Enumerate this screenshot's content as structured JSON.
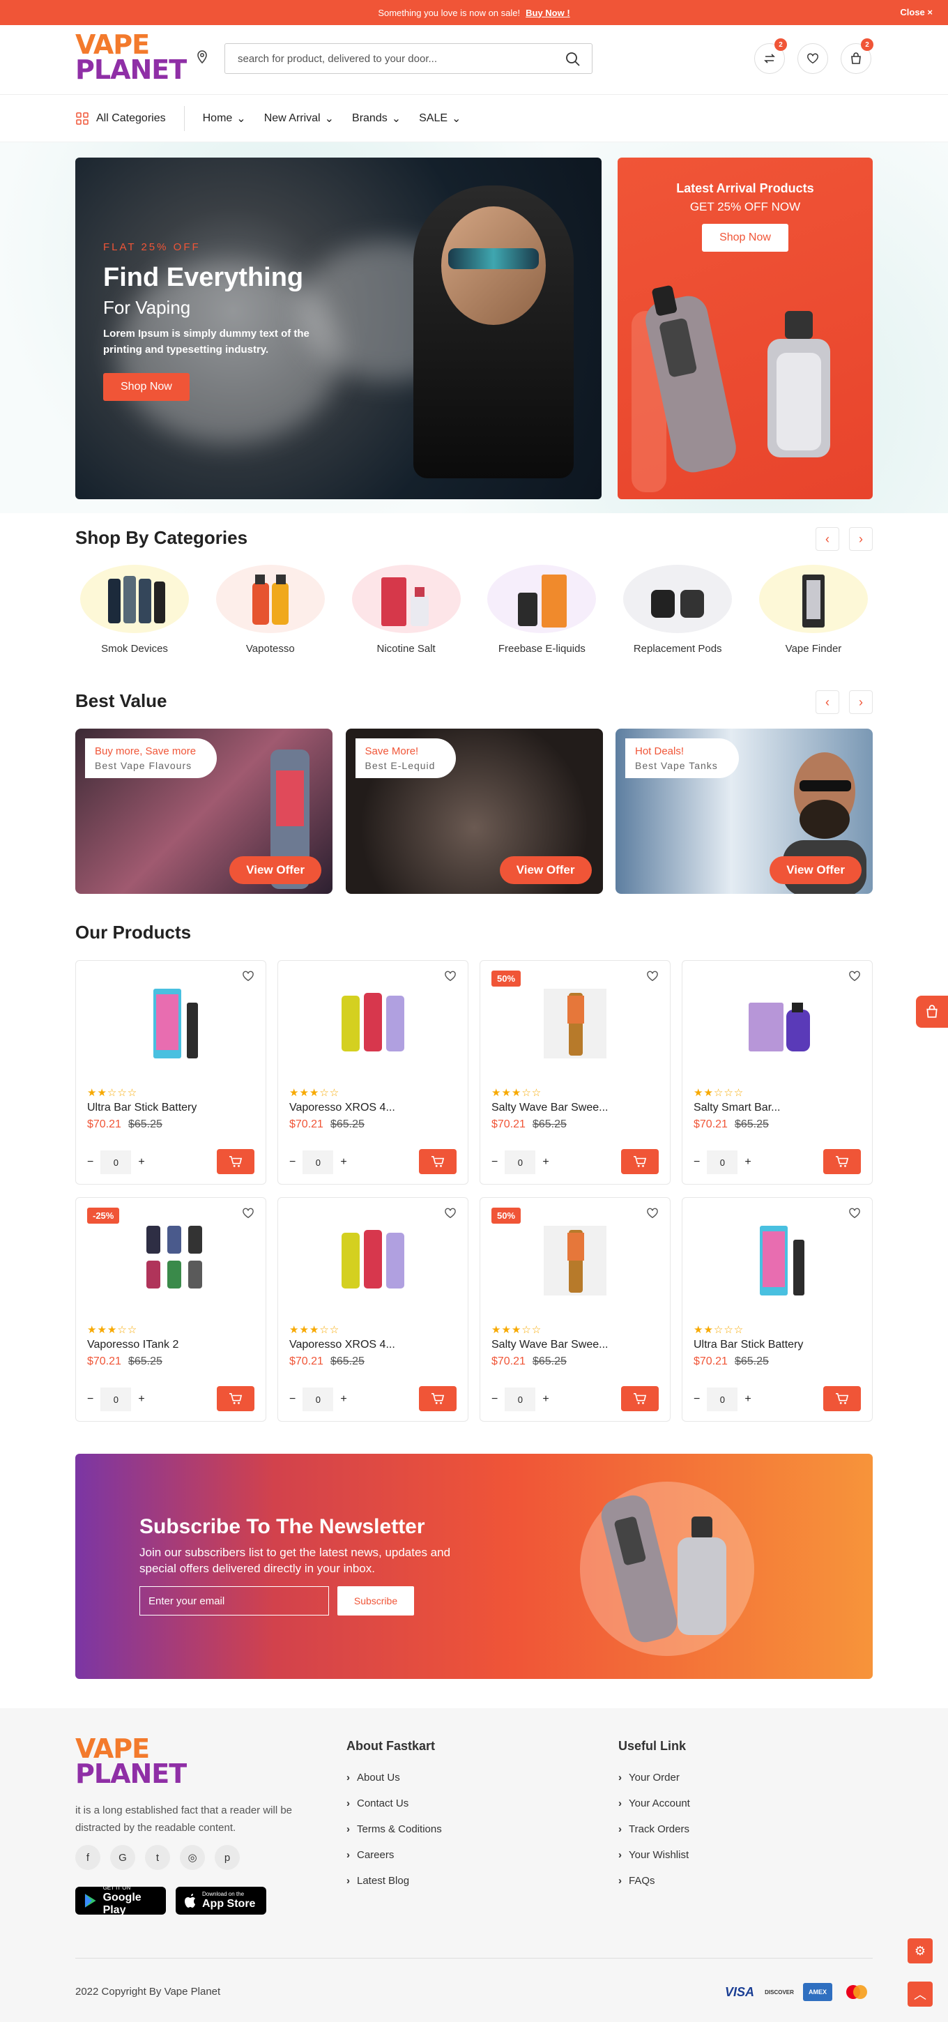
{
  "topbar": {
    "message": "Something you love is now on sale!",
    "buy": "Buy Now !",
    "close": "Close ×"
  },
  "brand": {
    "line1": "VAPE",
    "line2": "PLANET"
  },
  "search": {
    "placeholder": "search for product, delivered to your door..."
  },
  "header": {
    "compare_count": "2",
    "cart_count": "2"
  },
  "nav": {
    "all_categories": "All Categories",
    "items": [
      "Home",
      "New Arrival",
      "Brands",
      "SALE"
    ]
  },
  "hero": {
    "flat": "FLAT 25% OFF",
    "title": "Find Everything",
    "subtitle": "For Vaping",
    "desc": "Lorem Ipsum is simply dummy text of the printing and typesetting industry.",
    "button": "Shop Now",
    "right_title": "Latest Arrival Products",
    "right_sub": "GET 25% OFF NOW",
    "right_button": "Shop Now"
  },
  "categories": {
    "title": "Shop By Categories",
    "items": [
      {
        "label": "Smok Devices",
        "bg": "#fdf8d7"
      },
      {
        "label": "Vapotesso",
        "bg": "#fdeeea"
      },
      {
        "label": "Nicotine Salt",
        "bg": "#fde5e8"
      },
      {
        "label": "Freebase E-liquids",
        "bg": "#f6eefb"
      },
      {
        "label": "Replacement Pods",
        "bg": "#f0f0f3"
      },
      {
        "label": "Vape Finder",
        "bg": "#fdf8d7"
      }
    ]
  },
  "best_value": {
    "title": "Best Value",
    "offers": [
      {
        "t1": "Buy more, Save more",
        "t2": "Best Vape Flavours",
        "button": "View Offer"
      },
      {
        "t1": "Save More!",
        "t2": "Best E-Lequid",
        "button": "View Offer"
      },
      {
        "t1": "Hot Deals!",
        "t2": "Best Vape Tanks",
        "button": "View Offer"
      }
    ]
  },
  "products": {
    "title": "Our Products",
    "items": [
      {
        "name": "Ultra Bar Stick Battery",
        "price": "$70.21",
        "old": "$65.25",
        "qty": "0",
        "stars": "★★☆☆☆",
        "discount": ""
      },
      {
        "name": "Vaporesso XROS 4...",
        "price": "$70.21",
        "old": "$65.25",
        "qty": "0",
        "stars": "★★★☆☆",
        "discount": ""
      },
      {
        "name": "Salty Wave Bar Swee...",
        "price": "$70.21",
        "old": "$65.25",
        "qty": "0",
        "stars": "★★★☆☆",
        "discount": "50%"
      },
      {
        "name": "Salty Smart Bar...",
        "price": "$70.21",
        "old": "$65.25",
        "qty": "0",
        "stars": "★★☆☆☆",
        "discount": ""
      },
      {
        "name": "Vaporesso ITank 2",
        "price": "$70.21",
        "old": "$65.25",
        "qty": "0",
        "stars": "★★★☆☆",
        "discount": "-25%"
      },
      {
        "name": "Vaporesso XROS 4...",
        "price": "$70.21",
        "old": "$65.25",
        "qty": "0",
        "stars": "★★★☆☆",
        "discount": ""
      },
      {
        "name": "Salty Wave Bar Swee...",
        "price": "$70.21",
        "old": "$65.25",
        "qty": "0",
        "stars": "★★★☆☆",
        "discount": "50%"
      },
      {
        "name": "Ultra Bar Stick Battery",
        "price": "$70.21",
        "old": "$65.25",
        "qty": "0",
        "stars": "★★☆☆☆",
        "discount": ""
      }
    ]
  },
  "newsletter": {
    "title": "Subscribe To The Newsletter",
    "desc": "Join our subscribers list to get the latest news, updates and special offers delivered directly in your inbox.",
    "placeholder": "Enter your email",
    "button": "Subscribe"
  },
  "footer": {
    "desc": "it is a long established fact that a reader will be distracted by the readable content.",
    "about_title": "About Fastkart",
    "about_links": [
      "About Us",
      "Contact Us",
      "Terms & Coditions",
      "Careers",
      "Latest Blog"
    ],
    "useful_title": "Useful Link",
    "useful_links": [
      "Your Order",
      "Your Account",
      "Track Orders",
      "Your Wishlist",
      "FAQs"
    ],
    "google_small": "GET IT ON",
    "google_big": "Google Play",
    "apple_small": "Download on the",
    "apple_big": "App Store",
    "copyright": "2022 Copyright By Vape Planet",
    "payments": [
      "VISA",
      "DISCOVER",
      "AMEX",
      "MasterCard"
    ]
  },
  "colors": {
    "accent": "#f05537",
    "brand_orange": "#f37a2c",
    "brand_purple": "#8f2fa6"
  }
}
